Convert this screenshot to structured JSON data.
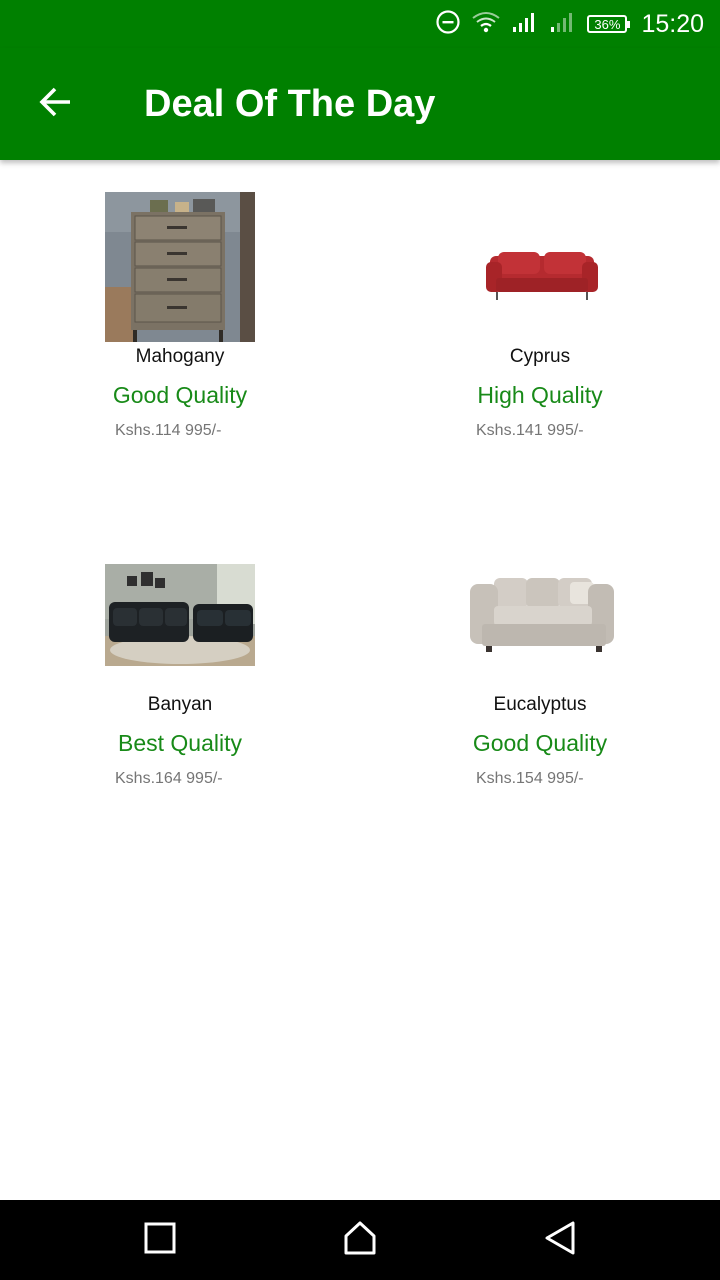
{
  "status": {
    "battery": "36%",
    "time": "15:20"
  },
  "appbar": {
    "title": "Deal Of The Day"
  },
  "products": [
    {
      "name": "Mahogany",
      "quality": "Good Quality",
      "price": "Kshs.114 995/-"
    },
    {
      "name": "Cyprus",
      "quality": "High Quality",
      "price": "Kshs.141 995/-"
    },
    {
      "name": "Banyan",
      "quality": "Best Quality",
      "price": "Kshs.164 995/-"
    },
    {
      "name": "Eucalyptus",
      "quality": "Good Quality",
      "price": "Kshs.154 995/-"
    }
  ],
  "colors": {
    "primary": "#008000",
    "quality_text": "#188a18",
    "price_text": "#757575"
  },
  "icons": {
    "status": [
      "dnd-icon",
      "wifi-icon",
      "signal-icon",
      "signal-weak-icon",
      "battery-icon"
    ],
    "nav": [
      "recents-icon",
      "home-icon",
      "back-triangle-icon"
    ],
    "appbar": "back-arrow-icon"
  }
}
